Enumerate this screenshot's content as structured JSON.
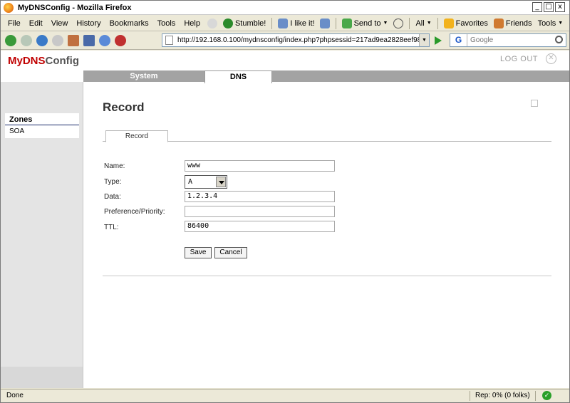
{
  "window": {
    "title": "MyDNSConfig - Mozilla Firefox",
    "controls": {
      "minimize": "_",
      "maximize": "□",
      "close": "x"
    }
  },
  "menubar": {
    "items": [
      "File",
      "Edit",
      "View",
      "History",
      "Bookmarks",
      "Tools",
      "Help"
    ],
    "stumble": "Stumble!",
    "ilikeit": "I like it!",
    "sendto": "Send to",
    "all": "All",
    "favorites": "Favorites",
    "friends": "Friends",
    "tools": "Tools"
  },
  "navbar": {
    "url": "http://192.168.0.100/mydnsconfig/index.php?phpsessid=217ad9ea2828eef983",
    "search_placeholder": "Google"
  },
  "app": {
    "logo_my": "My",
    "logo_dns": "DNS",
    "logo_config": "Config",
    "logout": "LOG OUT",
    "topnav": [
      "System",
      "DNS"
    ],
    "active_tab": "DNS",
    "sidebar": {
      "heading": "Zones",
      "items": [
        "SOA"
      ]
    }
  },
  "main": {
    "title": "Record",
    "tab": "Record",
    "fields": {
      "name": {
        "label": "Name:",
        "value": "www"
      },
      "type": {
        "label": "Type:",
        "value": "A"
      },
      "data": {
        "label": "Data:",
        "value": "1.2.3.4"
      },
      "preference": {
        "label": "Preference/Priority:",
        "value": ""
      },
      "ttl": {
        "label": "TTL:",
        "value": "86400"
      }
    },
    "save": "Save",
    "cancel": "Cancel"
  },
  "statusbar": {
    "status": "Done",
    "rep": "Rep: 0% (0 folks)"
  },
  "colors": {
    "brand_red": "#c00000",
    "nav_gray": "#a3a3a3",
    "ok_green": "#2aa02a"
  }
}
